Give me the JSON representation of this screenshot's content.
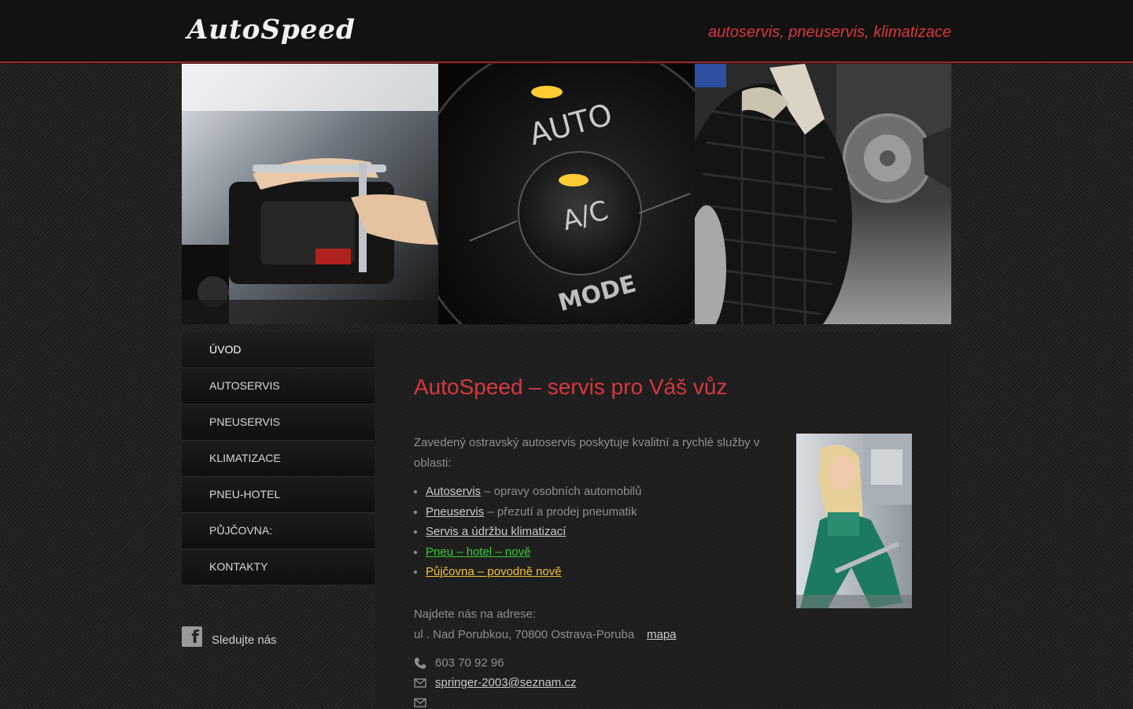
{
  "header": {
    "logo": "AutoSpeed",
    "tagline": "autoservis, pneuservis, klimatizace"
  },
  "banner": {
    "ac_labels": [
      "AUTO",
      "A/C",
      "MODE"
    ]
  },
  "nav": {
    "items": [
      {
        "label": "ÚVOD",
        "active": true
      },
      {
        "label": "AUTOSERVIS"
      },
      {
        "label": "PNEUSERVIS"
      },
      {
        "label": "KLIMATIZACE"
      },
      {
        "label": "PNEU-HOTEL"
      },
      {
        "label": "PŮJČOVNA:"
      },
      {
        "label": "KONTAKTY"
      }
    ]
  },
  "social": {
    "follow_label": "Sledujte nás",
    "icon": "facebook-icon"
  },
  "content": {
    "title": "AutoSpeed – servis pro Váš vůz",
    "intro": "Zavedený ostravský autoservis poskytuje kvalitní a rychlé služby v oblasti:",
    "services": [
      {
        "link": "Autoservis",
        "rest": " – opravy osobních automobilů"
      },
      {
        "link": "Pneuservis",
        "rest": " – přezutí a prodej pneumatik"
      },
      {
        "link": "Servis a údržbu klimatizací",
        "rest": ""
      },
      {
        "link": "Pneu – hotel – nově ",
        "rest": "",
        "color": "#33cc33"
      },
      {
        "link": "Půjčovna – povodně nově",
        "rest": "",
        "color": "#f2c230"
      }
    ],
    "address_label": "Najdete nás na adrese:",
    "address": "ul . Nad Porubkou, 70800 Ostrava-Poruba",
    "map_link": "mapa",
    "phone": "603 70 92 96",
    "email": "springer-2003@seznam.cz"
  },
  "colors": {
    "accent": "#d8373c",
    "green_link": "#33cc33",
    "yellow_link": "#f2c230"
  }
}
